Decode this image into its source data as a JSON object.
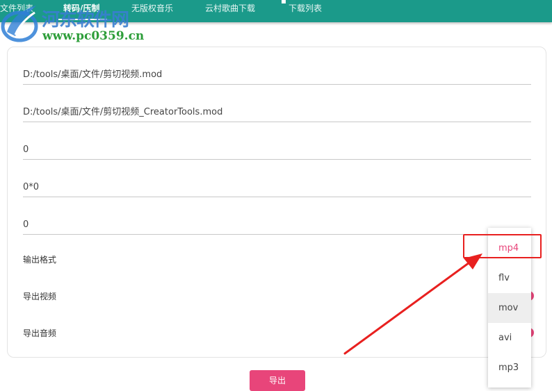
{
  "nav": {
    "tabs": [
      {
        "label": "文件列表"
      },
      {
        "label": "转码/压制"
      },
      {
        "label": "无版权音乐"
      },
      {
        "label": "云村歌曲下载"
      },
      {
        "label": "下载列表"
      }
    ],
    "active_index": 1
  },
  "watermark": {
    "name": "河东软件网",
    "url": "www.pc0359.cn"
  },
  "form": {
    "input_path": "D:/tools/桌面/文件/剪切视频.mod",
    "output_path": "D:/tools/桌面/文件/剪切视频_CreatorTools.mod",
    "field_3": "0",
    "resolution": "0*0",
    "field_5": "0",
    "output_format_label": "输出格式",
    "export_video_label": "导出视频",
    "export_audio_label": "导出音频"
  },
  "format_dropdown": {
    "options": [
      "mp4",
      "flv",
      "mov",
      "avi",
      "mp3"
    ],
    "selected": "mp4",
    "hovered": "mov"
  },
  "export_button": "导出",
  "colors": {
    "topbar": "#1b9a8a",
    "accent": "#e8457a",
    "annotation": "#e8201f"
  }
}
